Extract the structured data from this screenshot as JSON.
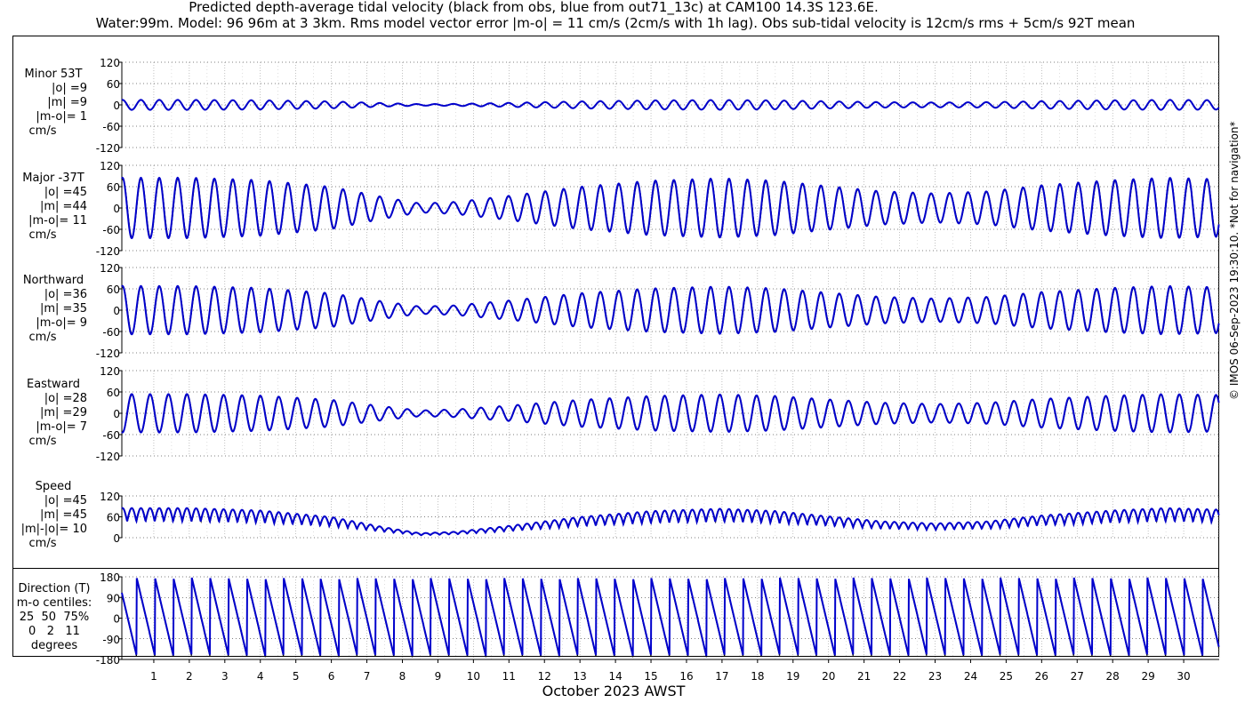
{
  "titles": {
    "line1": "Predicted depth-average tidal velocity (black from obs, blue from out71_13c) at CAM100 14.3S 123.6E.",
    "line2": "Water:99m. Model: 96 96m at 3 3km. Rms model vector error |m-o| = 11 cm/s (2cm/s with 1h lag). Obs sub-tidal velocity is 12cm/s rms + 5cm/s 92T mean"
  },
  "xlabel": "October 2023 AWST",
  "credit": "© IMOS 06-Sep-2023 19:30:10. *Not for navigation*",
  "colors": {
    "obs": "#000000",
    "model": "#0000cc",
    "grid": "#9a9a9a"
  },
  "chart_data": {
    "type": "line",
    "x_unit": "day of October 2023",
    "xlim": [
      0.1,
      31.0
    ],
    "x_ticks": [
      "1",
      "2",
      "3",
      "4",
      "5",
      "6",
      "7",
      "8",
      "9",
      "10",
      "11",
      "12",
      "13",
      "14",
      "15",
      "16",
      "17",
      "18",
      "19",
      "20",
      "21",
      "22",
      "23",
      "24",
      "25",
      "26",
      "27",
      "28",
      "29",
      "30"
    ],
    "series_names": [
      "obs",
      "model"
    ],
    "panels": [
      {
        "id": "minor",
        "ylim": [
          -120,
          120
        ],
        "ticks": [
          "120",
          "60",
          "0",
          "-60",
          "-120"
        ],
        "amp": 14,
        "phase": 0,
        "label": [
          "Minor 53T",
          "|o| =9",
          "|m| =9",
          "|m-o|= 1",
          "cm/s"
        ]
      },
      {
        "id": "major",
        "ylim": [
          -120,
          120
        ],
        "ticks": [
          "120",
          "60",
          "0",
          "-60",
          "-120"
        ],
        "amp": 85,
        "phase": 0,
        "label": [
          "Major -37T",
          "|o| =45",
          "|m| =44",
          "|m-o|= 11",
          "cm/s"
        ]
      },
      {
        "id": "north",
        "ylim": [
          -120,
          120
        ],
        "ticks": [
          "120",
          "60",
          "0",
          "-60",
          "-120"
        ],
        "amp": 68,
        "phase": 0,
        "label": [
          "Northward",
          "|o| =36",
          "|m| =35",
          "|m-o|= 9",
          "cm/s"
        ]
      },
      {
        "id": "east",
        "ylim": [
          -120,
          120
        ],
        "ticks": [
          "120",
          "60",
          "0",
          "-60",
          "-120"
        ],
        "amp": 54,
        "phase": 3.14,
        "label": [
          "Eastward",
          "|o| =28",
          "|m| =29",
          "|m-o|= 7",
          "cm/s"
        ]
      },
      {
        "id": "speed",
        "ylim": [
          0,
          120
        ],
        "ticks": [
          "120",
          "60",
          "0"
        ],
        "amp": 85,
        "phase": 0,
        "label": [
          "Speed",
          "|o| =45",
          "|m| =45",
          "|m|-|o|= 10",
          "cm/s"
        ]
      },
      {
        "id": "direction",
        "ylim": [
          -180,
          180
        ],
        "ticks": [
          "180",
          "90",
          "0",
          "-90",
          "-180"
        ],
        "amp": 180,
        "phase": 0,
        "label": [
          "Direction (T)",
          "m-o centiles:",
          "25  50  75%",
          "0   2   11",
          "degrees"
        ]
      }
    ],
    "spring_neap_envelope": {
      "days": [
        0.1,
        2,
        4,
        6,
        7.5,
        8.5,
        9.5,
        11,
        13,
        15,
        17,
        18.5,
        20,
        21.5,
        23,
        24.5,
        26,
        28,
        29.5,
        31
      ],
      "relative_amplitude": [
        1.0,
        1.0,
        0.92,
        0.7,
        0.35,
        0.15,
        0.2,
        0.4,
        0.7,
        0.9,
        0.98,
        0.9,
        0.72,
        0.55,
        0.48,
        0.55,
        0.75,
        0.92,
        1.0,
        0.95
      ]
    },
    "tidal_period_days": 0.5175
  }
}
